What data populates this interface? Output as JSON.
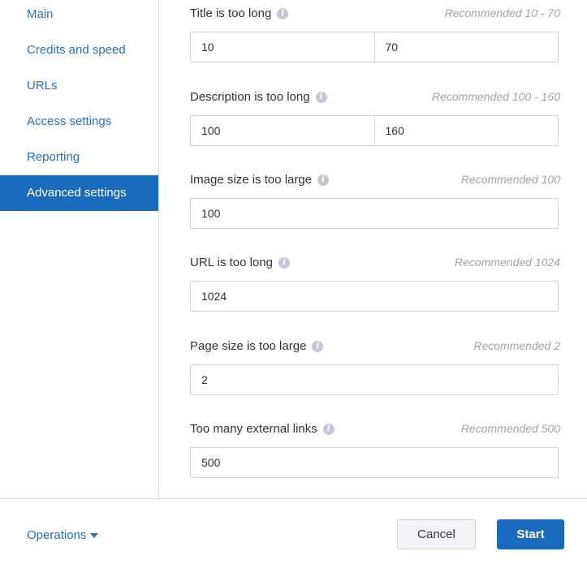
{
  "sidebar": {
    "items": [
      {
        "label": "Main",
        "active": false
      },
      {
        "label": "Credits and speed",
        "active": false
      },
      {
        "label": "URLs",
        "active": false
      },
      {
        "label": "Access settings",
        "active": false
      },
      {
        "label": "Reporting",
        "active": false
      },
      {
        "label": "Advanced settings",
        "active": true
      }
    ]
  },
  "fields": [
    {
      "label": "Title is too long",
      "recommendation": "Recommended 10 - 70",
      "values": [
        "10",
        "70"
      ]
    },
    {
      "label": "Description is too long",
      "recommendation": "Recommended 100 - 160",
      "values": [
        "100",
        "160"
      ]
    },
    {
      "label": "Image size is too large",
      "recommendation": "Recommended 100",
      "values": [
        "100"
      ]
    },
    {
      "label": "URL is too long",
      "recommendation": "Recommended 1024",
      "values": [
        "1024"
      ]
    },
    {
      "label": "Page size is too large",
      "recommendation": "Recommended 2",
      "values": [
        "2"
      ]
    },
    {
      "label": "Too many external links",
      "recommendation": "Recommended 500",
      "values": [
        "500"
      ]
    }
  ],
  "info_icon": "info-icon",
  "footer": {
    "operations_label": "Operations",
    "cancel_label": "Cancel",
    "start_label": "Start"
  },
  "colors": {
    "accent": "#1b6bbd",
    "link": "#2a6fba",
    "muted": "#a0a3ab"
  }
}
